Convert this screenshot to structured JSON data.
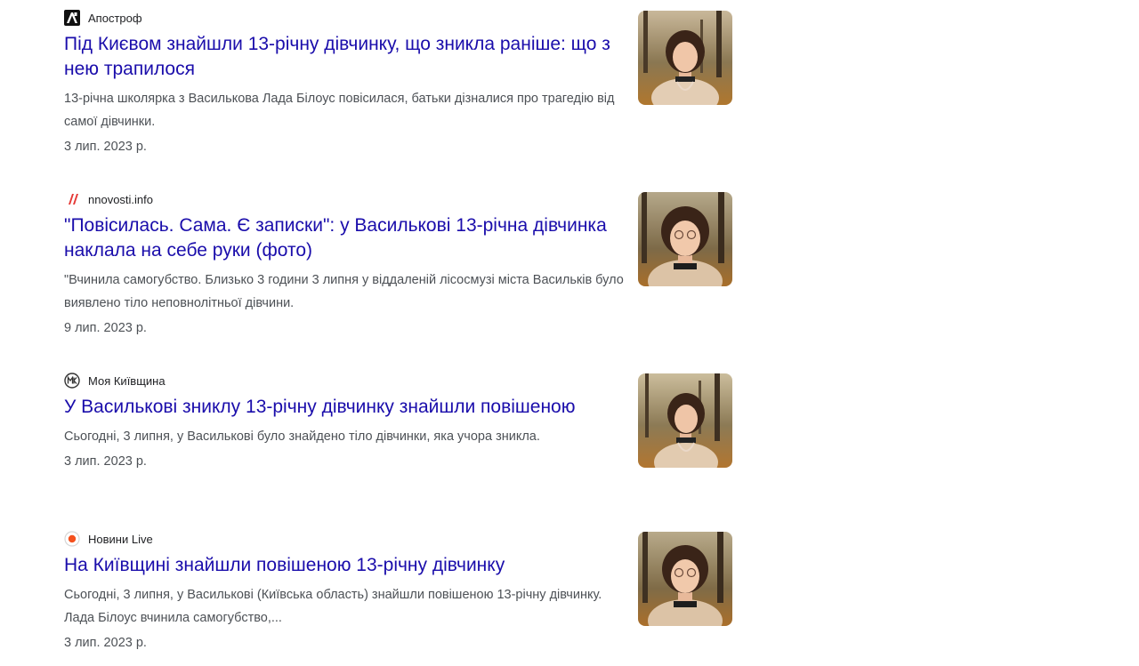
{
  "results": [
    {
      "source": "Апостроф",
      "source_icon": "apostrophe-logo-icon",
      "title": "Під Києвом знайшли 13-річну дівчинку, що зникла раніше: що з нею трапилося",
      "snippet": "13-річна школярка з Василькова Лада Білоус повісилася, батьки дізналися про трагедію від самої дівчинки.",
      "date": "3 лип. 2023 р.",
      "thumbnail": "girl-portrait-photo"
    },
    {
      "source": "nnovosti.info",
      "source_icon": "slashes-logo-icon",
      "title": "\"Повісилась. Сама. Є записки\": у Василькові 13-річна дівчинка наклала на себе руки (фото)",
      "snippet": "\"Вчинила самогубство. Близько 3 години 3 липня у віддаленій лісосмузі міста Васильків було виявлено тіло неповнолітньої дівчини.",
      "date": "9 лип. 2023 р.",
      "thumbnail": "girl-portrait-photo"
    },
    {
      "source": "Моя Київщина",
      "source_icon": "mk-circle-logo-icon",
      "title": "У Василькові зниклу 13-річну дівчинку знайшли повішеною",
      "snippet": "Сьогодні, 3 липня, у Василькові було знайдено тіло дівчинки, яка учора зникла.",
      "date": "3 лип. 2023 р.",
      "thumbnail": "girl-portrait-photo"
    },
    {
      "source": "Новини Live",
      "source_icon": "orange-dot-logo-icon",
      "title": "На Київщині знайшли повішеною 13-річну дівчинку",
      "snippet": "Сьогодні, 3 липня, у Василькові (Київська область) знайшли повішеною 13-річну дівчинку. Лада Білоус вчинила самогубство,...",
      "date": "3 лип. 2023 р.",
      "thumbnail": "girl-portrait-photo"
    }
  ],
  "colors": {
    "title_link": "#1a0dab",
    "snippet_text": "#4d5156",
    "source_text": "#202124",
    "nnovosti_accent": "#e53935",
    "novyny_live_accent": "#f4511e"
  }
}
